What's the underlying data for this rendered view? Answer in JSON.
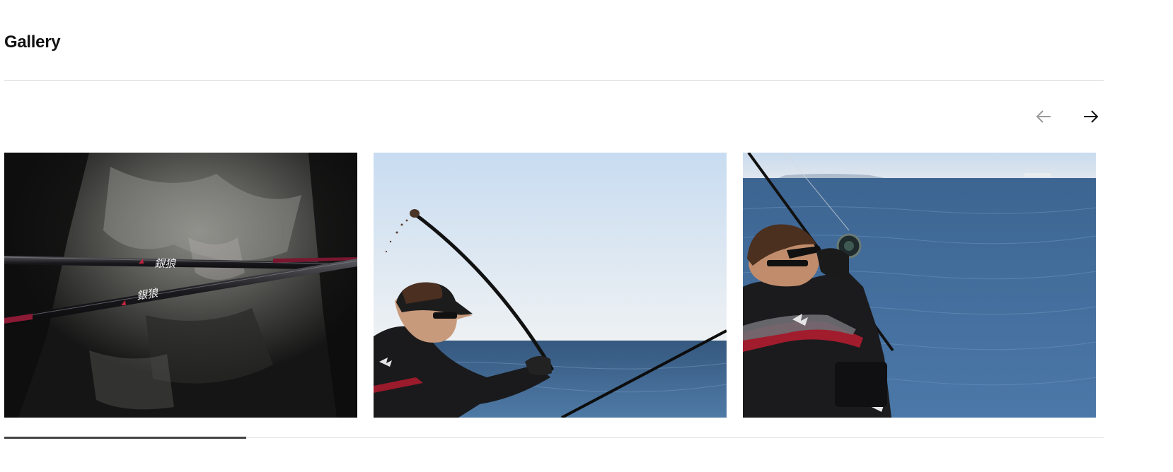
{
  "section": {
    "title": "Gallery"
  },
  "carousel": {
    "prev_icon": "arrow-left-icon",
    "next_icon": "arrow-right-icon",
    "prev_disabled": true,
    "slides": [
      {
        "name": "fishing-rods-on-rock",
        "rod_brand_text": "銀狼"
      },
      {
        "name": "angler-casting-bait-scoop"
      },
      {
        "name": "angler-fighting-fish"
      }
    ],
    "scroll_progress": 0.22
  },
  "colors": {
    "arrow_active": "#111111",
    "arrow_disabled": "#9a9a9a",
    "sky": "#d4e3f3",
    "sea": "#3c6592"
  }
}
